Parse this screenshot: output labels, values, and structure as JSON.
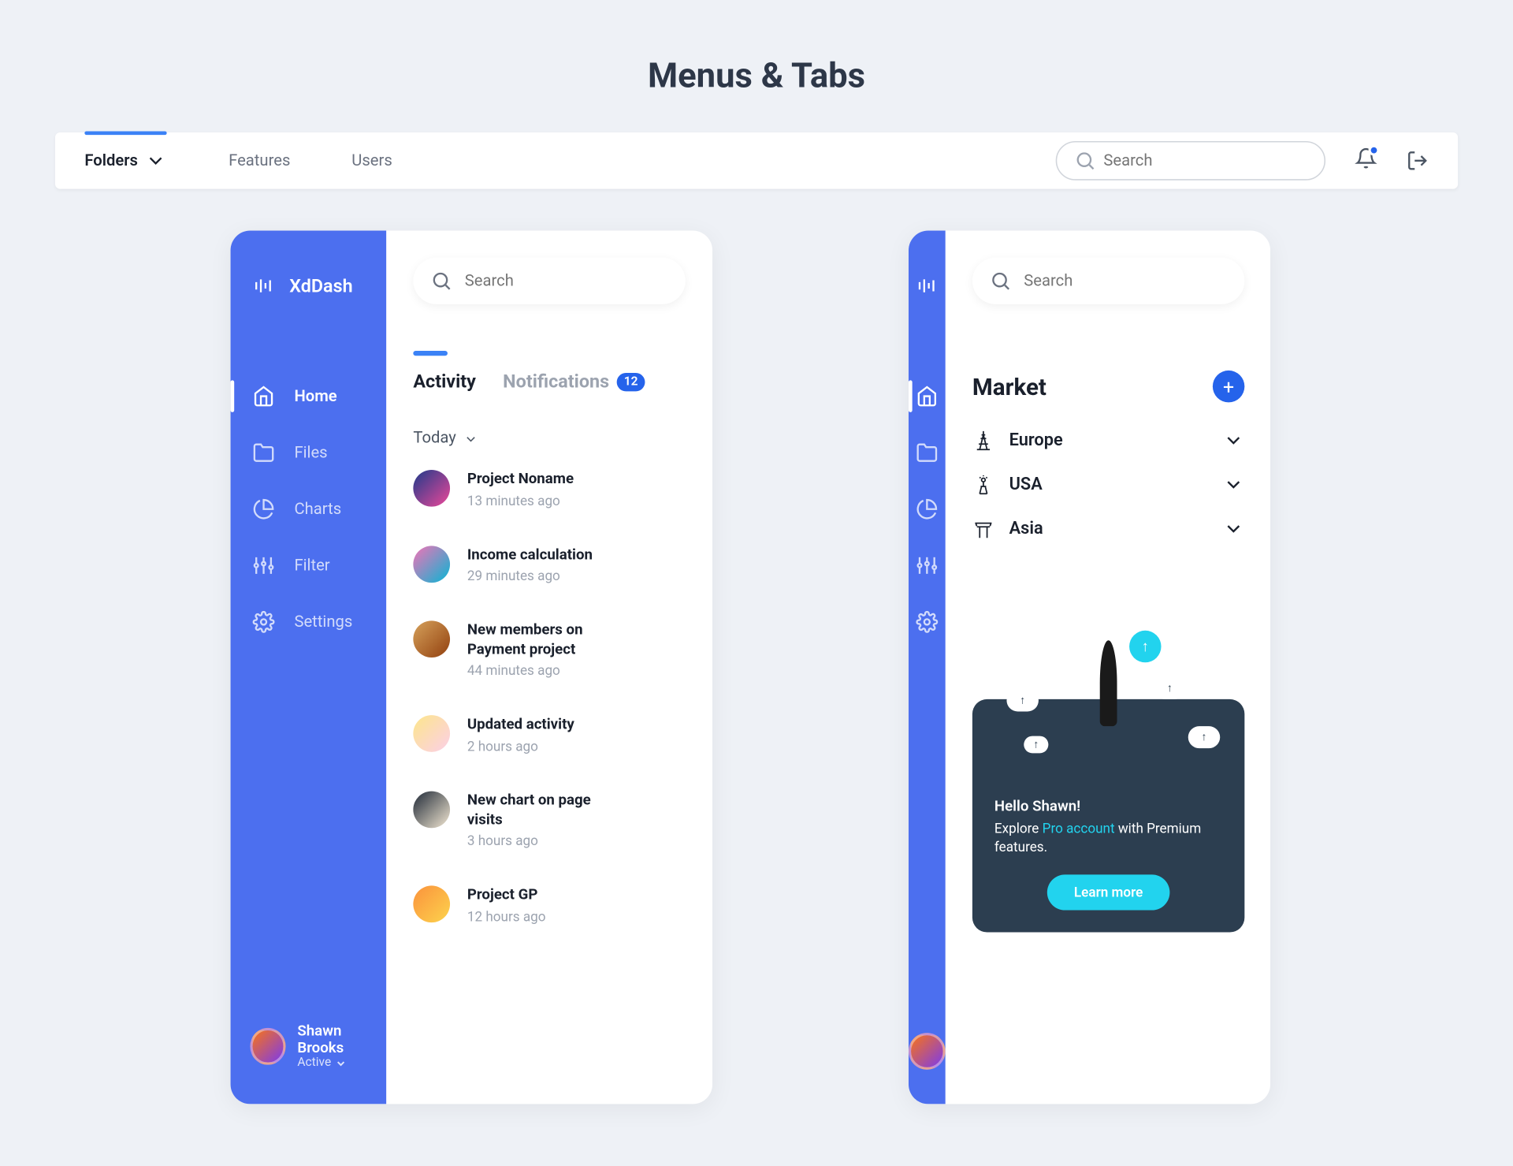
{
  "page_title": "Menus & Tabs",
  "topbar": {
    "tabs": [
      "Folders",
      "Features",
      "Users"
    ],
    "search_placeholder": "Search"
  },
  "panel1": {
    "brand": "XdDash",
    "search_placeholder": "Search",
    "nav": [
      {
        "label": "Home",
        "icon": "home",
        "active": true
      },
      {
        "label": "Files",
        "icon": "folder"
      },
      {
        "label": "Charts",
        "icon": "pie"
      },
      {
        "label": "Filter",
        "icon": "sliders"
      },
      {
        "label": "Settings",
        "icon": "gear"
      }
    ],
    "user": {
      "name": "Shawn Brooks",
      "status": "Active"
    },
    "inner_tabs": {
      "activity": "Activity",
      "notifications": "Notifications",
      "badge": "12"
    },
    "today_label": "Today",
    "feed": [
      {
        "title": "Project Noname",
        "time": "13 minutes ago"
      },
      {
        "title": "Income calculation",
        "time": "29 minutes ago"
      },
      {
        "title": "New members on Payment project",
        "time": "44 minutes ago"
      },
      {
        "title": "Updated activity",
        "time": "2 hours ago"
      },
      {
        "title": "New chart on page visits",
        "time": "3 hours ago"
      },
      {
        "title": "Project GP",
        "time": "12 hours ago"
      }
    ]
  },
  "panel2": {
    "search_placeholder": "Search",
    "market_title": "Market",
    "regions": [
      "Europe",
      "USA",
      "Asia"
    ],
    "promo": {
      "hello": "Hello Shawn!",
      "line1a": "Explore ",
      "pro": "Pro account",
      "line1b": " with Premium features.",
      "button": "Learn more"
    }
  }
}
